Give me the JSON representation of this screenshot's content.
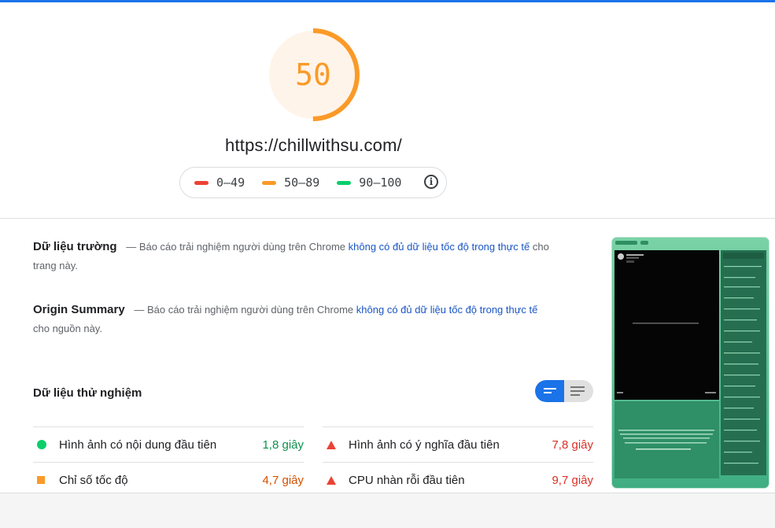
{
  "score": {
    "value": "50",
    "color": "#fa9a28",
    "fraction": 0.5
  },
  "url": "https://chillwithsu.com/",
  "legend": {
    "ranges": [
      {
        "label": "0–49",
        "color": "#eb4335"
      },
      {
        "label": "50–89",
        "color": "#fa9a28"
      },
      {
        "label": "90–100",
        "color": "#0cce6b"
      }
    ],
    "info_icon": "info-icon"
  },
  "field_data": {
    "title": "Dữ liệu trường",
    "dash": "—",
    "pre": "Báo cáo trải nghiệm người dùng trên Chrome",
    "link": "không có đủ dữ liệu tốc độ trong thực tế",
    "post": "cho trang này."
  },
  "origin_summary": {
    "title": "Origin Summary",
    "dash": "—",
    "pre": "Báo cáo trải nghiệm người dùng trên Chrome",
    "link": "không có đủ dữ liệu tốc độ trong thực tế",
    "post": "cho nguồn này."
  },
  "lab_data": {
    "title": "Dữ liệu thử nghiệm",
    "view_toggle": {
      "selected": "list-view",
      "icons": [
        "list-view-icon",
        "detail-view-icon"
      ]
    }
  },
  "metrics": [
    {
      "label": "Hình ảnh có nội dung đầu tiên",
      "value": "1,8 giây",
      "status": "pass",
      "color": "#0d904f"
    },
    {
      "label": "Hình ảnh có ý nghĩa đầu tiên",
      "value": "7,8 giây",
      "status": "fail",
      "color": "#d93025"
    },
    {
      "label": "Chỉ số tốc độ",
      "value": "4,7 giây",
      "status": "average",
      "color": "#d25000"
    },
    {
      "label": "CPU nhàn rỗi đầu tiên",
      "value": "9,7 giây",
      "status": "fail",
      "color": "#d93025"
    }
  ],
  "colors": {
    "accent": "#1a73e8",
    "link": "#1a56c4",
    "thumbnail_bg": "#4db890"
  }
}
